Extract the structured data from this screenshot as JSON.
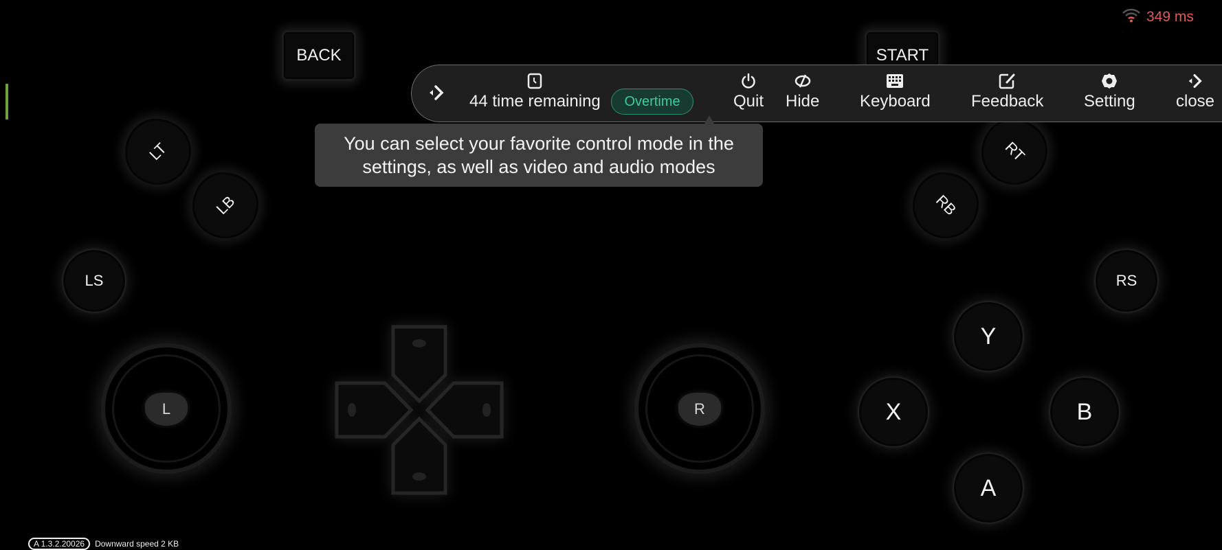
{
  "status": {
    "latency": "349 ms",
    "latency_color": "#e05a5a",
    "signal_icon": "wifi-icon"
  },
  "toolbar": {
    "collapse_icon": "arrow-right-icon",
    "time_remaining": "44 time remaining",
    "clock_icon": "clock-icon",
    "overtime_label": "Overtime",
    "overtime_color": "#3fcaa0",
    "items": [
      {
        "label": "Quit",
        "icon": "power-icon"
      },
      {
        "label": "Hide",
        "icon": "hide-icon"
      },
      {
        "label": "Keyboard",
        "icon": "keyboard-icon"
      },
      {
        "label": "Feedback",
        "icon": "edit-icon"
      },
      {
        "label": "Setting",
        "icon": "gear-icon"
      },
      {
        "label": "close",
        "icon": "arrow-right-icon"
      }
    ]
  },
  "tooltip": {
    "line1": "You can select your favorite control mode in the",
    "line2": "settings, as well as  video and audio modes"
  },
  "gamepad": {
    "back": "BACK",
    "start": "START",
    "lt": "LT",
    "lb": "LB",
    "rt": "RT",
    "rb": "RB",
    "ls": "LS",
    "rs": "RS",
    "left_stick": "L",
    "right_stick": "R",
    "y": "Y",
    "x": "X",
    "b": "B",
    "a": "A"
  },
  "footer": {
    "version": "A 1.3.2.20026",
    "speed": "Downward speed 2 KB"
  }
}
